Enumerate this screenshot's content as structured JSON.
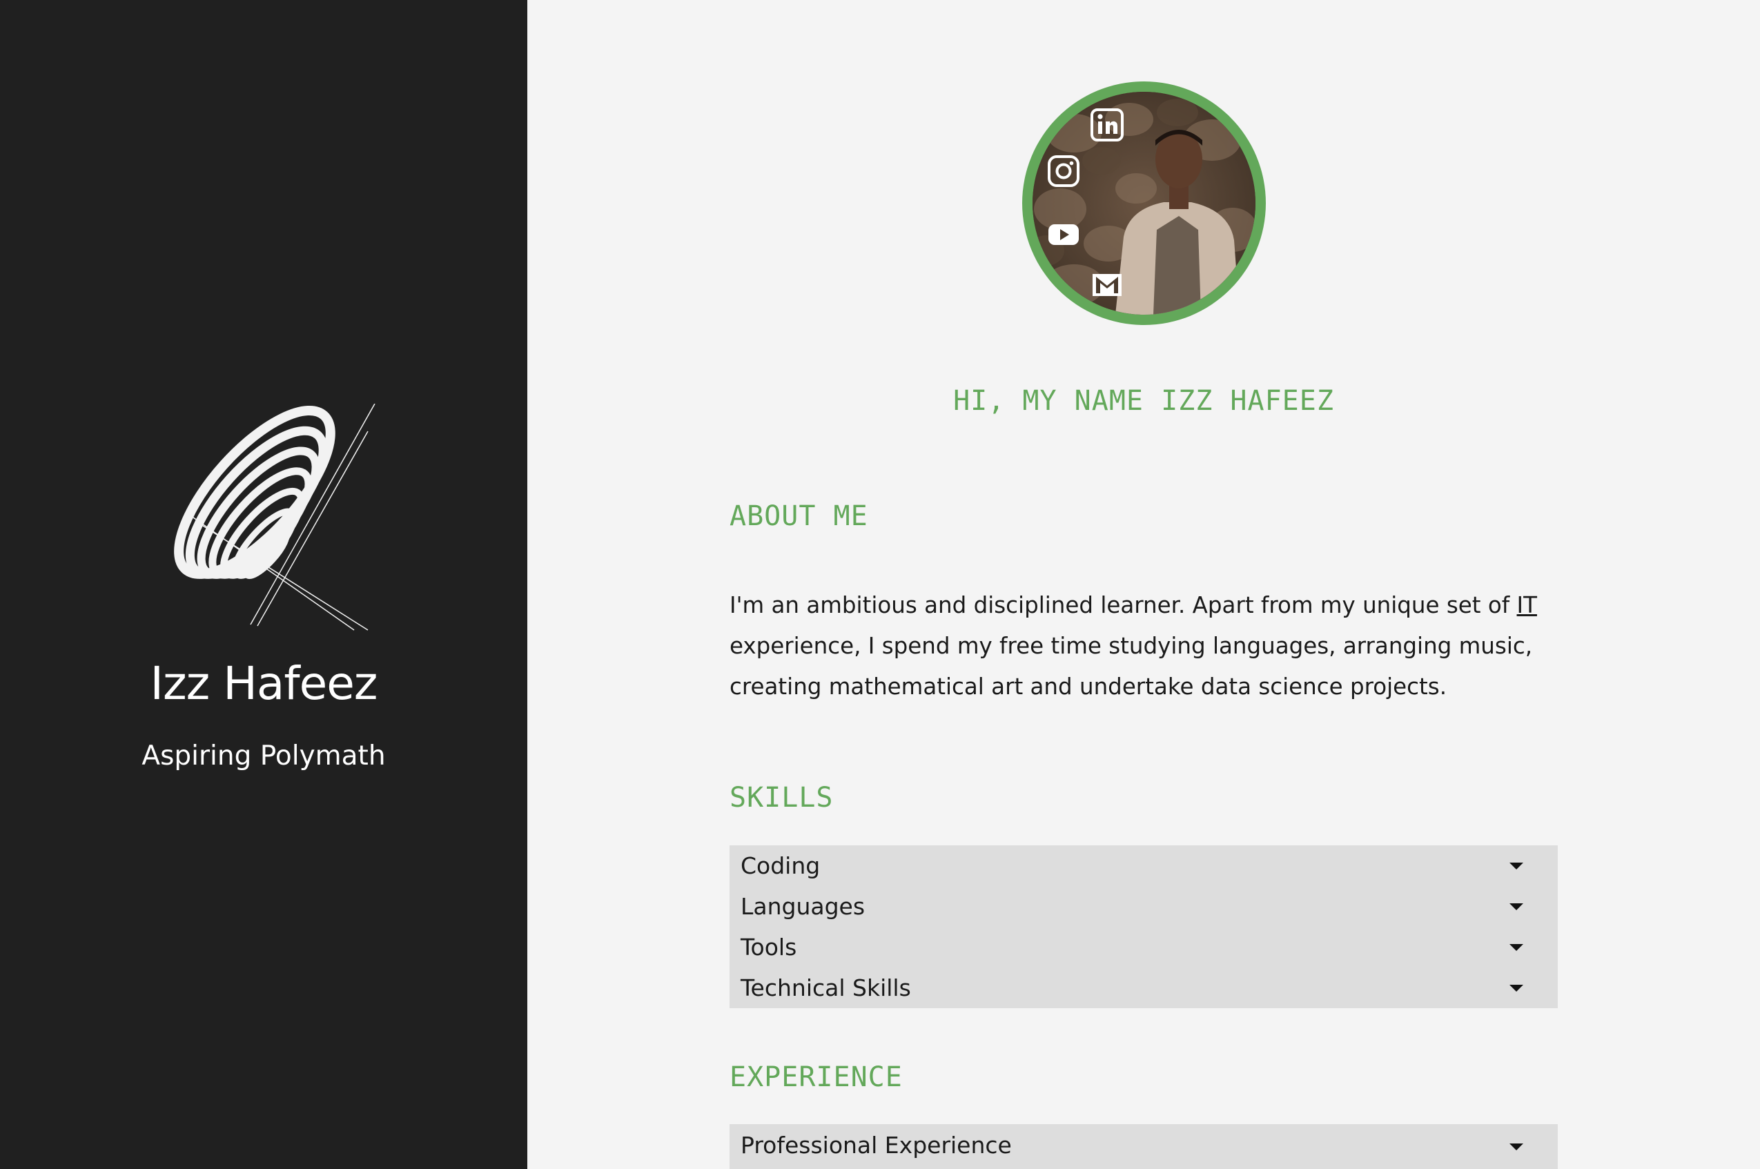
{
  "sidebar": {
    "name": "Izz Hafeez",
    "tagline": "Aspiring Polymath",
    "logo_icon": "spiral-rings-logo"
  },
  "profile": {
    "photo_icon": "profile-photo",
    "ring_color": "#63a85a",
    "social_links": [
      {
        "icon": "linkedin-icon"
      },
      {
        "icon": "instagram-icon"
      },
      {
        "icon": "youtube-icon"
      },
      {
        "icon": "gmail-icon"
      }
    ]
  },
  "greeting": "HI, MY NAME IZZ HAFEEZ",
  "about": {
    "heading": "ABOUT ME",
    "text_before": "I'm an ambitious and disciplined learner. Apart from my unique set of ",
    "link_text": "IT",
    "text_after": " experience, I spend my free time studying languages, arranging music, creating mathematical art and undertake data science projects."
  },
  "skills": {
    "heading": "SKILLS",
    "items": [
      "Coding",
      "Languages",
      "Tools",
      "Technical Skills"
    ]
  },
  "experience": {
    "heading": "EXPERIENCE",
    "items": [
      "Professional Experience"
    ]
  },
  "colors": {
    "accent": "#63a85a",
    "sidebar_bg": "#202020",
    "main_bg": "#f4f4f4",
    "accordion_bg": "#dddddd"
  }
}
